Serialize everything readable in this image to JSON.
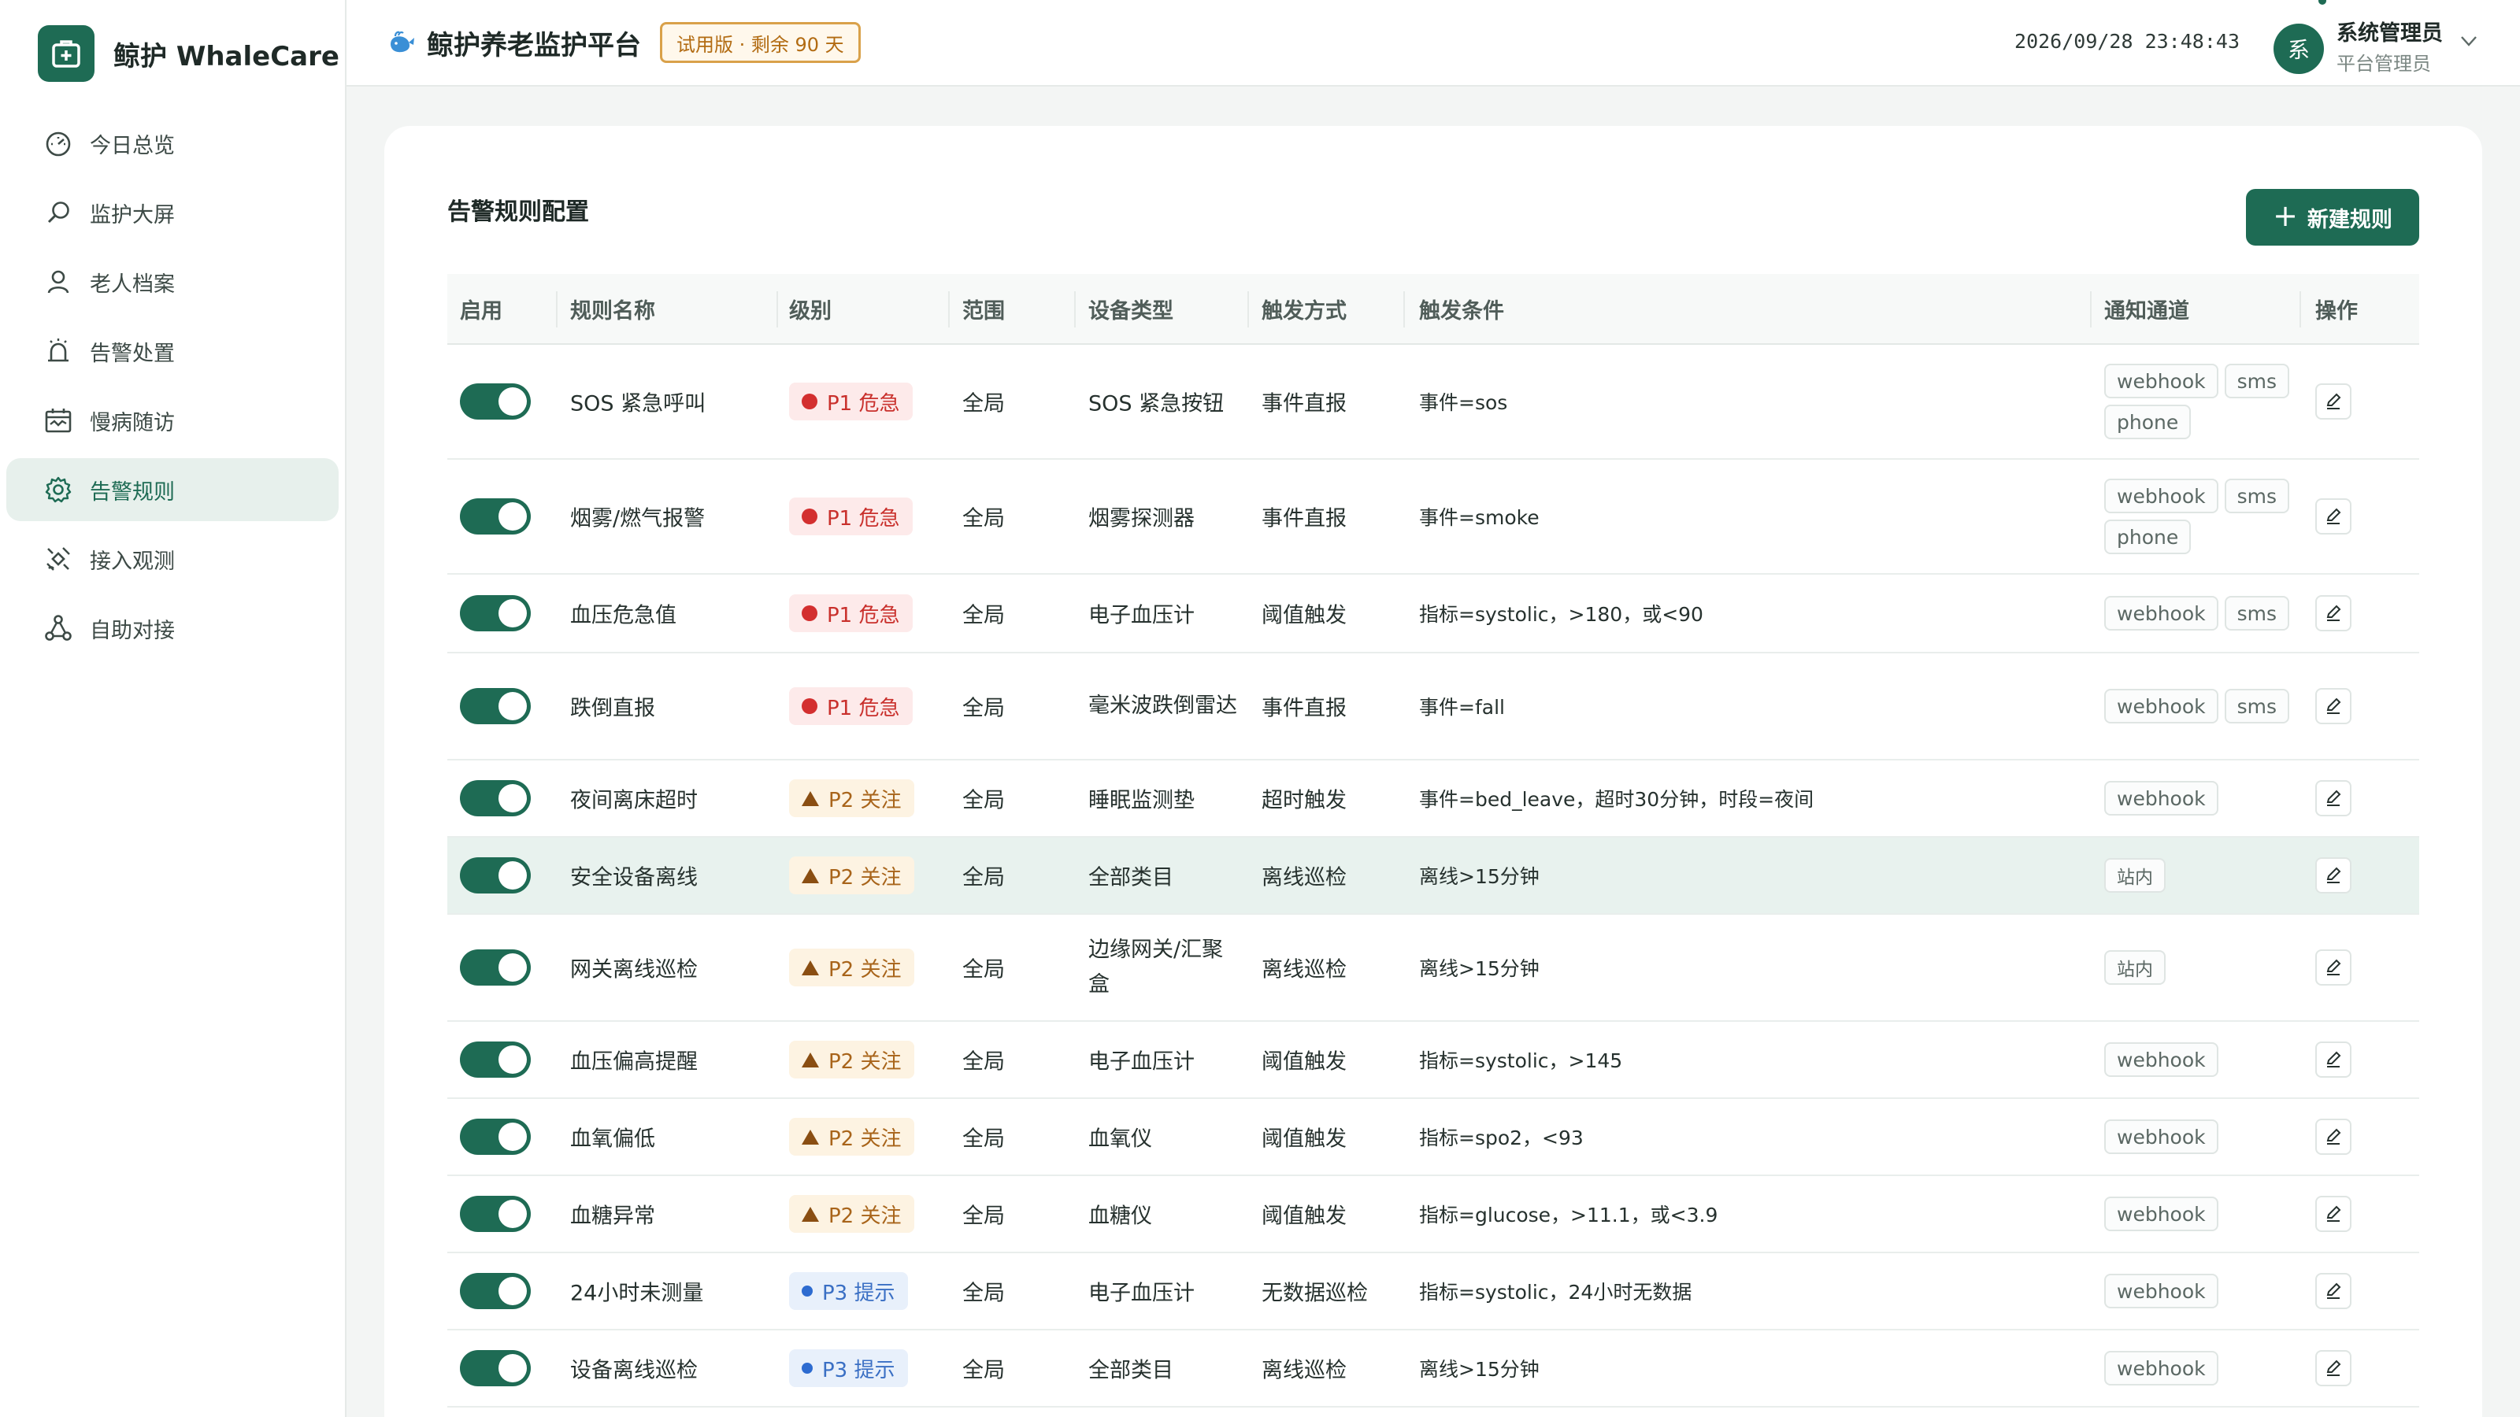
{
  "brand": {
    "name": "鲸护 WhaleCare"
  },
  "nav": [
    {
      "label": "今日总览",
      "icon": "dashboard-gauge-icon",
      "active": false
    },
    {
      "label": "监护大屏",
      "icon": "magnifier-icon",
      "active": false
    },
    {
      "label": "老人档案",
      "icon": "person-icon",
      "active": false
    },
    {
      "label": "告警处置",
      "icon": "alarm-bell-icon",
      "active": false
    },
    {
      "label": "慢病随访",
      "icon": "calendar-followup-icon",
      "active": false
    },
    {
      "label": "告警规则",
      "icon": "gear-icon",
      "active": true
    },
    {
      "label": "接入观测",
      "icon": "satellite-icon",
      "active": false
    },
    {
      "label": "自助对接",
      "icon": "network-nodes-icon",
      "active": false
    }
  ],
  "header": {
    "title": "鲸护养老监护平台",
    "trial_badge": "试用版 · 剩余 90 天",
    "datetime": "2026/09/28 23:48:43",
    "user": {
      "avatar": "系",
      "name": "系统管理员",
      "role": "平台管理员"
    }
  },
  "page": {
    "title": "告警规则配置",
    "new_button": "新建规则"
  },
  "columns": [
    "启用",
    "规则名称",
    "级别",
    "范围",
    "设备类型",
    "触发方式",
    "触发条件",
    "通知通道",
    "操作"
  ],
  "colors": {
    "primary": "#1e6b54",
    "p1": "#d32f2f",
    "p2": "#8a4e12",
    "p3": "#2d6bd0"
  },
  "rules": [
    {
      "enabled": true,
      "name": "SOS 紧急呼叫",
      "level": "P1 危急",
      "level_key": "p1",
      "scope": "全局",
      "device": "SOS 紧急按钮",
      "trigger": "事件直报",
      "condition": "事件=sos",
      "channels": [
        "webhook",
        "sms",
        "phone"
      ]
    },
    {
      "enabled": true,
      "name": "烟雾/燃气报警",
      "level": "P1 危急",
      "level_key": "p1",
      "scope": "全局",
      "device": "烟雾探测器",
      "trigger": "事件直报",
      "condition": "事件=smoke",
      "channels": [
        "webhook",
        "sms",
        "phone"
      ]
    },
    {
      "enabled": true,
      "name": "血压危急值",
      "level": "P1 危急",
      "level_key": "p1",
      "scope": "全局",
      "device": "电子血压计",
      "trigger": "阈值触发",
      "condition": "指标=systolic，>180，或<90",
      "channels": [
        "webhook",
        "sms"
      ]
    },
    {
      "enabled": true,
      "name": "跌倒直报",
      "level": "P1 危急",
      "level_key": "p1",
      "scope": "全局",
      "device": "毫米波跌倒雷达",
      "trigger": "事件直报",
      "condition": "事件=fall",
      "channels": [
        "webhook",
        "sms"
      ]
    },
    {
      "enabled": true,
      "name": "夜间离床超时",
      "level": "P2 关注",
      "level_key": "p2",
      "scope": "全局",
      "device": "睡眠监测垫",
      "trigger": "超时触发",
      "condition": "事件=bed_leave，超时30分钟，时段=夜间",
      "channels": [
        "webhook"
      ]
    },
    {
      "enabled": true,
      "name": "安全设备离线",
      "level": "P2 关注",
      "level_key": "p2",
      "scope": "全局",
      "device": "全部类目",
      "trigger": "离线巡检",
      "condition": "离线>15分钟",
      "channels": [
        "站内"
      ]
    },
    {
      "enabled": true,
      "name": "网关离线巡检",
      "level": "P2 关注",
      "level_key": "p2",
      "scope": "全局",
      "device": "边缘网关/汇聚盒",
      "trigger": "离线巡检",
      "condition": "离线>15分钟",
      "channels": [
        "站内"
      ]
    },
    {
      "enabled": true,
      "name": "血压偏高提醒",
      "level": "P2 关注",
      "level_key": "p2",
      "scope": "全局",
      "device": "电子血压计",
      "trigger": "阈值触发",
      "condition": "指标=systolic，>145",
      "channels": [
        "webhook"
      ]
    },
    {
      "enabled": true,
      "name": "血氧偏低",
      "level": "P2 关注",
      "level_key": "p2",
      "scope": "全局",
      "device": "血氧仪",
      "trigger": "阈值触发",
      "condition": "指标=spo2，<93",
      "channels": [
        "webhook"
      ]
    },
    {
      "enabled": true,
      "name": "血糖异常",
      "level": "P2 关注",
      "level_key": "p2",
      "scope": "全局",
      "device": "血糖仪",
      "trigger": "阈值触发",
      "condition": "指标=glucose，>11.1，或<3.9",
      "channels": [
        "webhook"
      ]
    },
    {
      "enabled": true,
      "name": "24小时未测量",
      "level": "P3 提示",
      "level_key": "p3",
      "scope": "全局",
      "device": "电子血压计",
      "trigger": "无数据巡检",
      "condition": "指标=systolic，24小时无数据",
      "channels": [
        "webhook"
      ]
    },
    {
      "enabled": true,
      "name": "设备离线巡检",
      "level": "P3 提示",
      "level_key": "p3",
      "scope": "全局",
      "device": "全部类目",
      "trigger": "离线巡检",
      "condition": "离线>15分钟",
      "channels": [
        "webhook"
      ]
    }
  ]
}
